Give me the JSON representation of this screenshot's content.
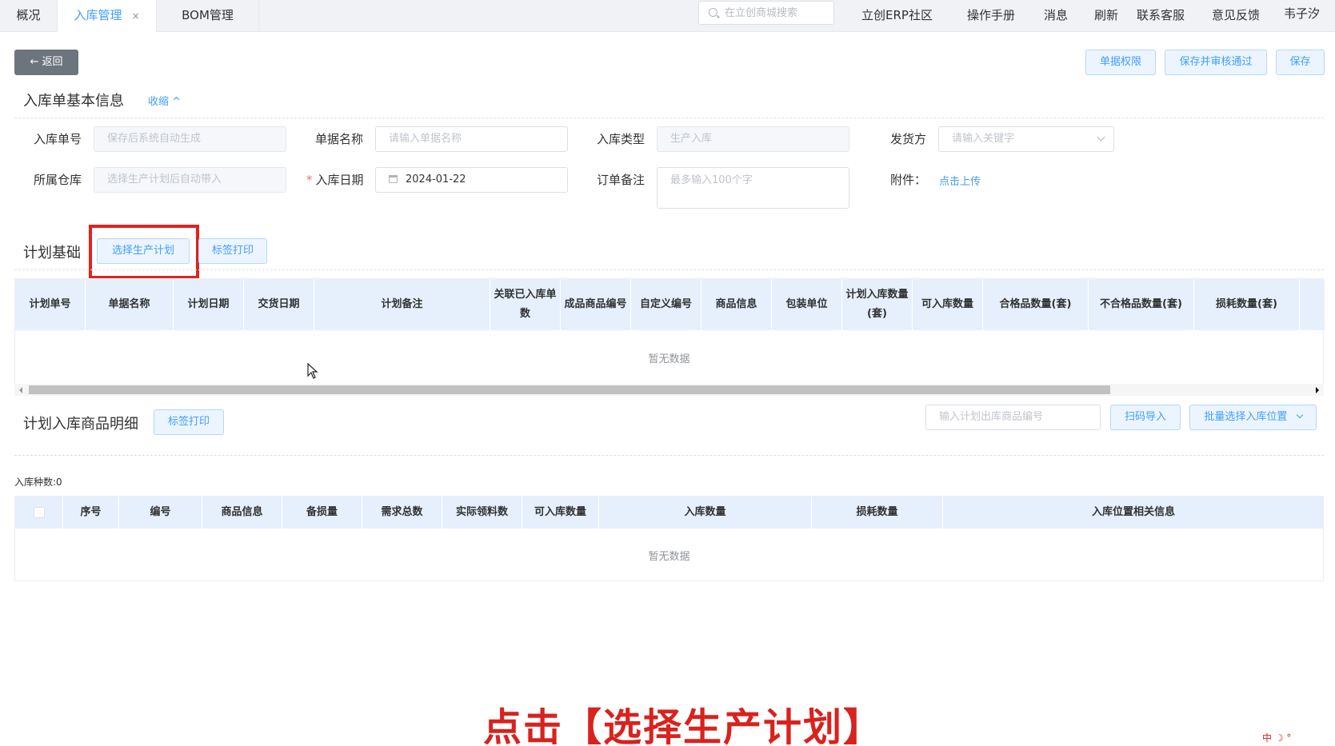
{
  "tabs": [
    {
      "label": "概况"
    },
    {
      "label": "入库管理",
      "close": "×"
    },
    {
      "label": "BOM管理"
    }
  ],
  "top": {
    "search_placeholder": "在立创商城搜索",
    "links": [
      "立创ERP社区",
      "操作手册",
      "消息",
      "刷新",
      "联系客服",
      "意见反馈",
      "韦子汐"
    ]
  },
  "toolbar": {
    "back": "← 返回",
    "doc_permission": "单据权限",
    "save_and_approve": "保存并审核通过",
    "save": "保存"
  },
  "basic": {
    "title": "入库单基本信息",
    "collapse": "收缩 ^",
    "fields": {
      "order_no_label": "入库单号",
      "order_no_placeholder": "保存后系统自动生成",
      "doc_name_label": "单据名称",
      "doc_name_placeholder": "请输入单据名称",
      "type_label": "入库类型",
      "type_placeholder": "生产入库",
      "shipper_label": "发货方",
      "shipper_placeholder": "请输入关键字",
      "warehouse_label": "所属仓库",
      "warehouse_placeholder": "选择生产计划后自动带入",
      "date_label": "入库日期",
      "date_required": "*",
      "date_value": "2024-01-22",
      "remark_label": "订单备注",
      "remark_placeholder": "最多输入100个字",
      "attach_label": "附件：",
      "attach_link": "点击上传"
    }
  },
  "plan": {
    "title": "计划基础",
    "select_plan": "选择生产计划",
    "label_print": "标签打印",
    "columns": [
      "计划单号",
      "单据名称",
      "计划日期",
      "交货日期",
      "计划备注",
      "关联已入库单数",
      "成品商品编号",
      "自定义编号",
      "商品信息",
      "包装单位",
      "计划入库数量(套)",
      "可入库数量",
      "合格品数量(套)",
      "不合格品数量(套)",
      "损耗数量(套)"
    ],
    "empty": "暂无数据"
  },
  "detail": {
    "title": "计划入库商品明细",
    "label_print": "标签打印",
    "search_placeholder": "输入计划出库商品编号",
    "scan_import": "扫码导入",
    "batch_location": "批量选择入库位置",
    "kinds": "入库种数:0",
    "columns": [
      "序号",
      "编号",
      "商品信息",
      "备损量",
      "需求总数",
      "实际领料数",
      "可入库数量",
      "入库数量",
      "损耗数量",
      "入库位置相关信息"
    ],
    "empty": "暂无数据"
  },
  "caption": "点击【选择生产计划】",
  "corner_mark": "中 ☽ °"
}
